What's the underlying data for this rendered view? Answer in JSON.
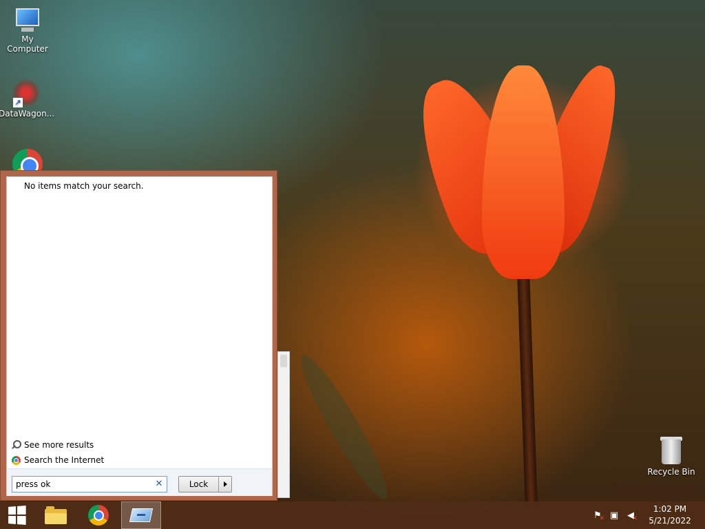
{
  "desktop": {
    "icons": {
      "my_computer": "My Computer",
      "datawagon": "DataWagon...",
      "recycle_bin": "Recycle Bin"
    }
  },
  "search_popup": {
    "no_results_text": "No items match your search.",
    "see_more_results": "See more results",
    "search_internet": "Search the Internet",
    "search_value": "press ok",
    "clear_symbol": "✕",
    "power_button_label": "Lock"
  },
  "taskbar": {
    "pinned": [
      "start-icon",
      "file-explorer-icon",
      "chrome-icon",
      "remote-desktop-icon"
    ],
    "tray_icons": [
      "action-center-flag-icon",
      "network-icon",
      "volume-muted-icon"
    ],
    "clock_time": "1:02 PM",
    "clock_date": "5/21/2022"
  }
}
